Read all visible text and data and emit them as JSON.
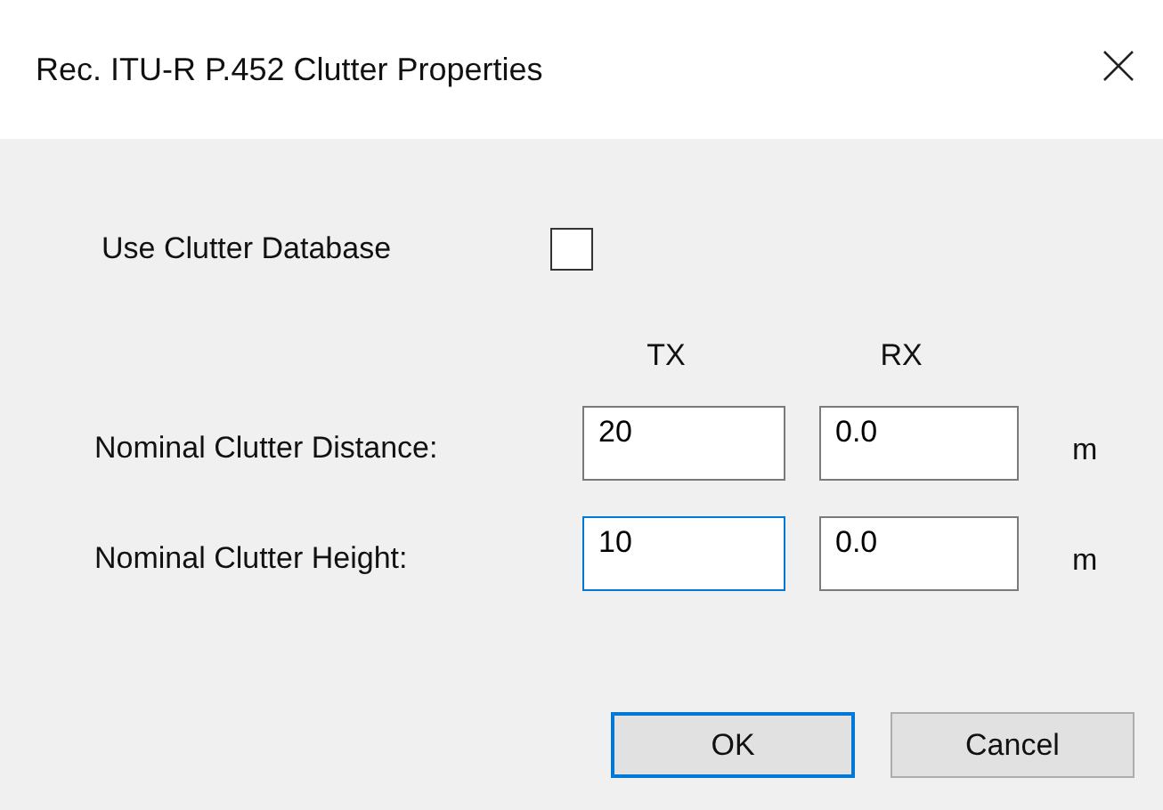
{
  "window": {
    "title": "Rec. ITU-R P.452 Clutter Properties"
  },
  "use_database": {
    "label": "Use Clutter Database",
    "checked": false
  },
  "columns": [
    "TX",
    "RX"
  ],
  "rows": [
    {
      "label": "Nominal Clutter Distance:",
      "tx": {
        "value": "20",
        "focused": false
      },
      "rx": {
        "value": "0.0",
        "focused": false
      },
      "unit": "m"
    },
    {
      "label": "Nominal Clutter Height:",
      "tx": {
        "value": "10",
        "focused": true
      },
      "rx": {
        "value": "0.0",
        "focused": false
      },
      "unit": "m"
    }
  ],
  "buttons": [
    {
      "label": "OK",
      "default": true
    },
    {
      "label": "Cancel",
      "default": false
    }
  ]
}
